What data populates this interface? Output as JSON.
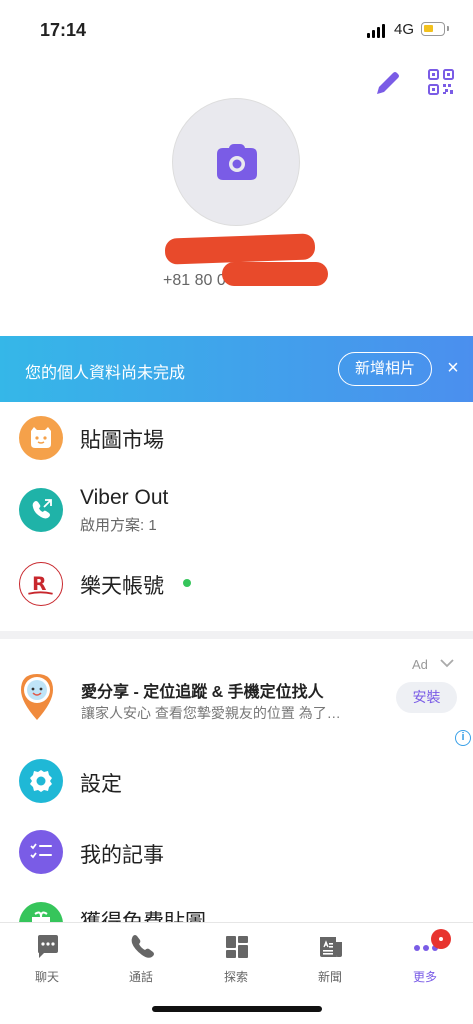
{
  "status": {
    "time": "17:14",
    "network": "4G"
  },
  "profile": {
    "phone": "+81 80 0"
  },
  "banner": {
    "text": "您的個人資料尚未完成",
    "button": "新增相片",
    "close": "×"
  },
  "menu": {
    "sticker_market": "貼圖市場",
    "viber_out": {
      "label": "Viber Out",
      "sub": "啟用方案: 1"
    },
    "rakuten": "樂天帳號",
    "settings": "設定",
    "my_notes": "我的記事",
    "free_stickers": "獲得免費貼圖"
  },
  "ad": {
    "label": "Ad",
    "title": "愛分享 - 定位追蹤 & 手機定位找人",
    "desc": "讓家人安心 查看您摯愛親友的位置 為了…",
    "install": "安裝",
    "info": "i"
  },
  "tabs": [
    {
      "label": "聊天",
      "icon": "chat-icon"
    },
    {
      "label": "通話",
      "icon": "phone-icon"
    },
    {
      "label": "探索",
      "icon": "explore-icon"
    },
    {
      "label": "新聞",
      "icon": "news-icon"
    },
    {
      "label": "更多",
      "icon": "more-icon",
      "active": true
    }
  ],
  "colors": {
    "accent": "#7a5ce6",
    "banner_start": "#35b7e8",
    "banner_end": "#4b8fee",
    "redaction": "#e84a2b"
  }
}
